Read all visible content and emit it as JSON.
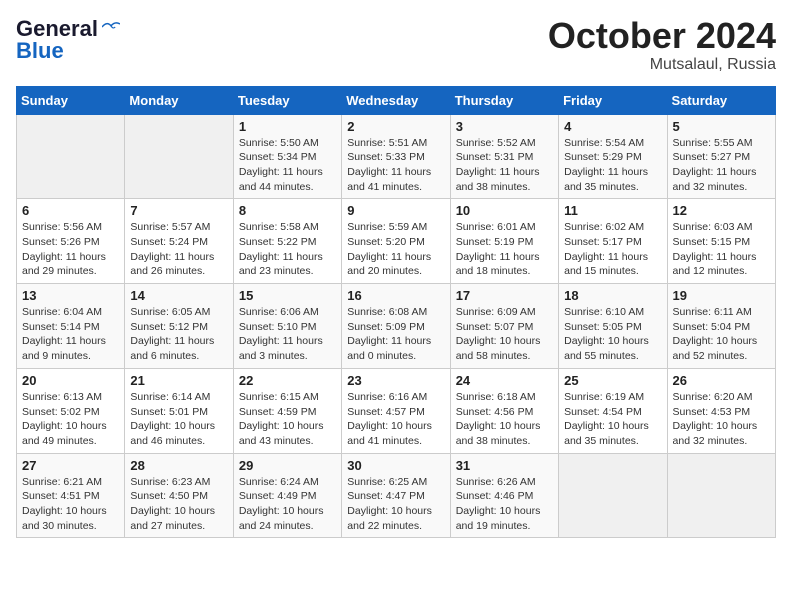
{
  "header": {
    "logo_line1": "General",
    "logo_line2": "Blue",
    "month": "October 2024",
    "location": "Mutsalaul, Russia"
  },
  "weekdays": [
    "Sunday",
    "Monday",
    "Tuesday",
    "Wednesday",
    "Thursday",
    "Friday",
    "Saturday"
  ],
  "weeks": [
    [
      {
        "day": "",
        "info": ""
      },
      {
        "day": "",
        "info": ""
      },
      {
        "day": "1",
        "info": "Sunrise: 5:50 AM\nSunset: 5:34 PM\nDaylight: 11 hours and 44 minutes."
      },
      {
        "day": "2",
        "info": "Sunrise: 5:51 AM\nSunset: 5:33 PM\nDaylight: 11 hours and 41 minutes."
      },
      {
        "day": "3",
        "info": "Sunrise: 5:52 AM\nSunset: 5:31 PM\nDaylight: 11 hours and 38 minutes."
      },
      {
        "day": "4",
        "info": "Sunrise: 5:54 AM\nSunset: 5:29 PM\nDaylight: 11 hours and 35 minutes."
      },
      {
        "day": "5",
        "info": "Sunrise: 5:55 AM\nSunset: 5:27 PM\nDaylight: 11 hours and 32 minutes."
      }
    ],
    [
      {
        "day": "6",
        "info": "Sunrise: 5:56 AM\nSunset: 5:26 PM\nDaylight: 11 hours and 29 minutes."
      },
      {
        "day": "7",
        "info": "Sunrise: 5:57 AM\nSunset: 5:24 PM\nDaylight: 11 hours and 26 minutes."
      },
      {
        "day": "8",
        "info": "Sunrise: 5:58 AM\nSunset: 5:22 PM\nDaylight: 11 hours and 23 minutes."
      },
      {
        "day": "9",
        "info": "Sunrise: 5:59 AM\nSunset: 5:20 PM\nDaylight: 11 hours and 20 minutes."
      },
      {
        "day": "10",
        "info": "Sunrise: 6:01 AM\nSunset: 5:19 PM\nDaylight: 11 hours and 18 minutes."
      },
      {
        "day": "11",
        "info": "Sunrise: 6:02 AM\nSunset: 5:17 PM\nDaylight: 11 hours and 15 minutes."
      },
      {
        "day": "12",
        "info": "Sunrise: 6:03 AM\nSunset: 5:15 PM\nDaylight: 11 hours and 12 minutes."
      }
    ],
    [
      {
        "day": "13",
        "info": "Sunrise: 6:04 AM\nSunset: 5:14 PM\nDaylight: 11 hours and 9 minutes."
      },
      {
        "day": "14",
        "info": "Sunrise: 6:05 AM\nSunset: 5:12 PM\nDaylight: 11 hours and 6 minutes."
      },
      {
        "day": "15",
        "info": "Sunrise: 6:06 AM\nSunset: 5:10 PM\nDaylight: 11 hours and 3 minutes."
      },
      {
        "day": "16",
        "info": "Sunrise: 6:08 AM\nSunset: 5:09 PM\nDaylight: 11 hours and 0 minutes."
      },
      {
        "day": "17",
        "info": "Sunrise: 6:09 AM\nSunset: 5:07 PM\nDaylight: 10 hours and 58 minutes."
      },
      {
        "day": "18",
        "info": "Sunrise: 6:10 AM\nSunset: 5:05 PM\nDaylight: 10 hours and 55 minutes."
      },
      {
        "day": "19",
        "info": "Sunrise: 6:11 AM\nSunset: 5:04 PM\nDaylight: 10 hours and 52 minutes."
      }
    ],
    [
      {
        "day": "20",
        "info": "Sunrise: 6:13 AM\nSunset: 5:02 PM\nDaylight: 10 hours and 49 minutes."
      },
      {
        "day": "21",
        "info": "Sunrise: 6:14 AM\nSunset: 5:01 PM\nDaylight: 10 hours and 46 minutes."
      },
      {
        "day": "22",
        "info": "Sunrise: 6:15 AM\nSunset: 4:59 PM\nDaylight: 10 hours and 43 minutes."
      },
      {
        "day": "23",
        "info": "Sunrise: 6:16 AM\nSunset: 4:57 PM\nDaylight: 10 hours and 41 minutes."
      },
      {
        "day": "24",
        "info": "Sunrise: 6:18 AM\nSunset: 4:56 PM\nDaylight: 10 hours and 38 minutes."
      },
      {
        "day": "25",
        "info": "Sunrise: 6:19 AM\nSunset: 4:54 PM\nDaylight: 10 hours and 35 minutes."
      },
      {
        "day": "26",
        "info": "Sunrise: 6:20 AM\nSunset: 4:53 PM\nDaylight: 10 hours and 32 minutes."
      }
    ],
    [
      {
        "day": "27",
        "info": "Sunrise: 6:21 AM\nSunset: 4:51 PM\nDaylight: 10 hours and 30 minutes."
      },
      {
        "day": "28",
        "info": "Sunrise: 6:23 AM\nSunset: 4:50 PM\nDaylight: 10 hours and 27 minutes."
      },
      {
        "day": "29",
        "info": "Sunrise: 6:24 AM\nSunset: 4:49 PM\nDaylight: 10 hours and 24 minutes."
      },
      {
        "day": "30",
        "info": "Sunrise: 6:25 AM\nSunset: 4:47 PM\nDaylight: 10 hours and 22 minutes."
      },
      {
        "day": "31",
        "info": "Sunrise: 6:26 AM\nSunset: 4:46 PM\nDaylight: 10 hours and 19 minutes."
      },
      {
        "day": "",
        "info": ""
      },
      {
        "day": "",
        "info": ""
      }
    ]
  ]
}
